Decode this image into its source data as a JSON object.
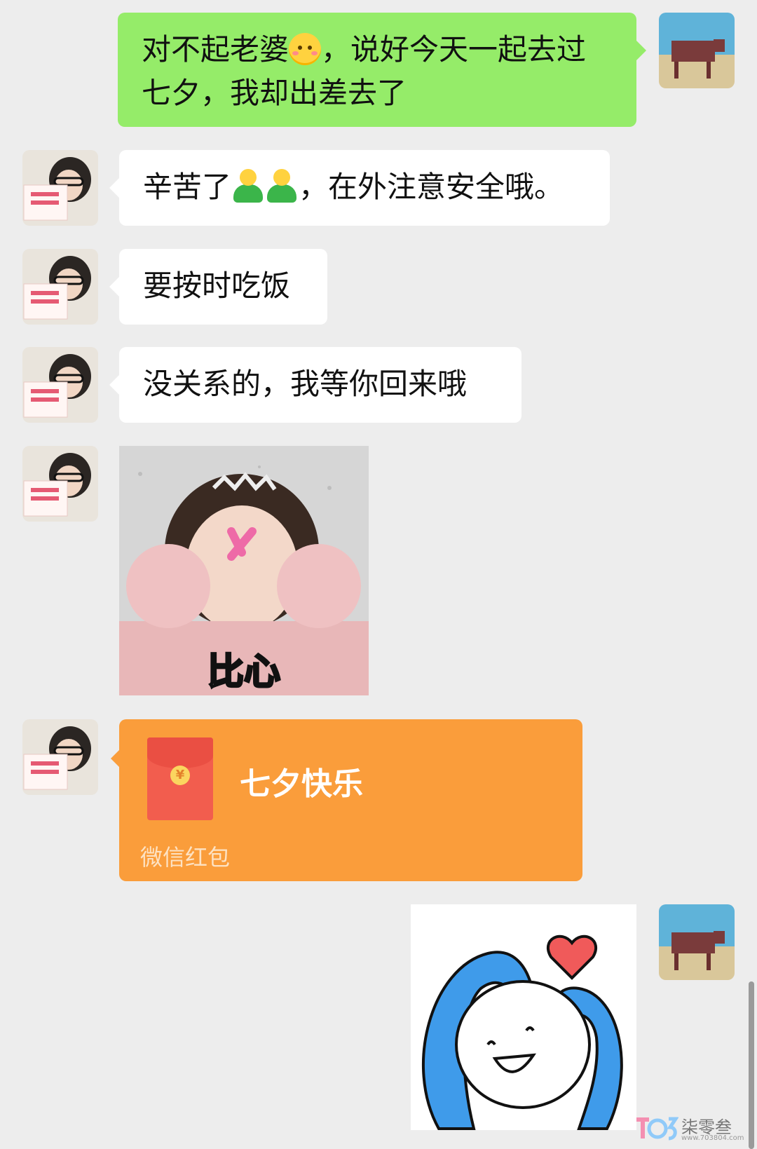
{
  "messages": [
    {
      "from": "me",
      "type": "text",
      "before_emoji": "对不起老婆",
      "after_emoji": "，说好今天一起去过七夕，我却出差去了",
      "emoji": "smiling-face-blush"
    },
    {
      "from": "wife",
      "type": "text",
      "before_emoji": "辛苦了",
      "after_emoji": "，在外注意安全哦。",
      "emoji": "person-hug"
    },
    {
      "from": "wife",
      "type": "text",
      "text": "要按时吃饭"
    },
    {
      "from": "wife",
      "type": "text",
      "text": "没关系的，我等你回来哦"
    },
    {
      "from": "wife",
      "type": "sticker",
      "caption": "比心"
    },
    {
      "from": "wife",
      "type": "red_packet",
      "title": "七夕快乐",
      "footer": "微信红包",
      "currency_symbol": "¥"
    },
    {
      "from": "me",
      "type": "sticker",
      "caption": ""
    }
  ],
  "watermark": {
    "brand": "柒零叁",
    "url": "www.703804.com"
  },
  "colors": {
    "background": "#ededed",
    "my_bubble": "#95ec69",
    "their_bubble": "#ffffff",
    "red_packet": "#fa9d3b"
  }
}
